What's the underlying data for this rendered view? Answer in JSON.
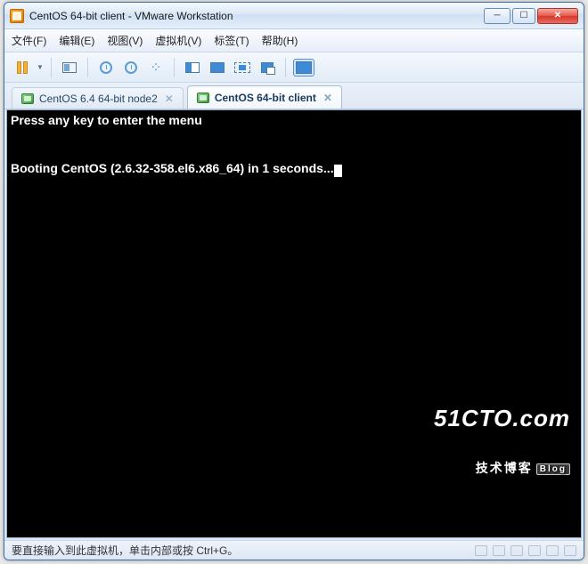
{
  "window": {
    "title": "CentOS 64-bit client - VMware Workstation"
  },
  "menu": {
    "file": "文件(F)",
    "edit": "编辑(E)",
    "view": "视图(V)",
    "vm": "虚拟机(V)",
    "tabs": "标签(T)",
    "help": "帮助(H)"
  },
  "toolbar_icons": {
    "pause": "pause-icon",
    "snapshot": "snapshot-icon",
    "snapshot_new": "snapshot-new-icon",
    "revert": "revert-icon",
    "manage": "snapshot-manage-icon",
    "fit": "fit-guest-icon",
    "fullscreen": "fullscreen-icon",
    "seamless": "seamless-icon",
    "unity": "unity-icon",
    "console": "console-view-icon"
  },
  "tabs": [
    {
      "label": "CentOS 6.4 64-bit node2",
      "active": false
    },
    {
      "label": "CentOS 64-bit client",
      "active": true
    }
  ],
  "console": {
    "line1": "Press any key to enter the menu",
    "line2": "",
    "line3": "",
    "line4": "Booting CentOS (2.6.32-358.el6.x86_64) in 1 seconds..."
  },
  "status": {
    "text": "要直接输入到此虚拟机，单击内部或按 Ctrl+G。"
  },
  "watermark": {
    "line1": "51CTO.com",
    "line2": "技术博客",
    "badge": "Blog"
  }
}
